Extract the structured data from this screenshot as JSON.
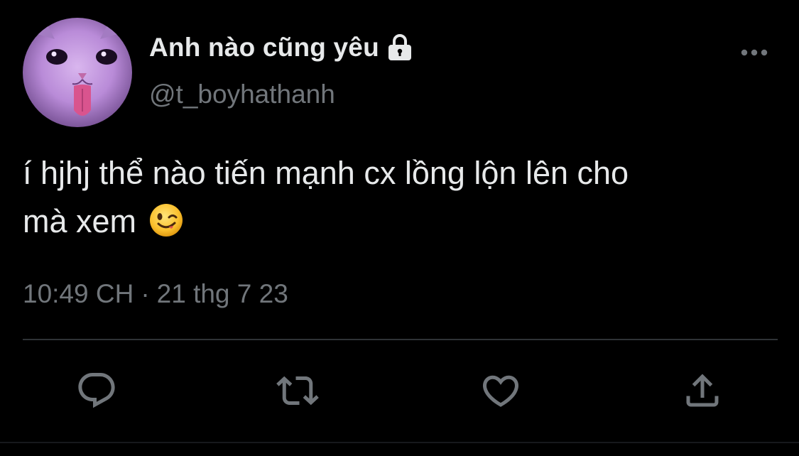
{
  "user": {
    "display_name": "Anh nào cũng yêu",
    "handle": "@t_boyhathanh",
    "avatar": "cat-avatar",
    "protected_icon": "lock-icon"
  },
  "tweet": {
    "text_line_1": "í hjhj thể nào tiến mạnh cx lồng lộn lên cho",
    "text_line_2": "mà xem",
    "emoji": "winking-face-emoji"
  },
  "meta": {
    "time": "10:49 CH",
    "separator": "·",
    "date": "21 thg 7 23"
  },
  "menu": {
    "more_icon": "more-horizontal-icon"
  },
  "actions": [
    {
      "name": "reply",
      "icon": "reply-icon"
    },
    {
      "name": "retweet",
      "icon": "retweet-icon"
    },
    {
      "name": "like",
      "icon": "heart-icon"
    },
    {
      "name": "share",
      "icon": "share-icon"
    }
  ],
  "colors": {
    "background": "#000000",
    "primary_text": "#e7e9ea",
    "secondary_text": "#71767b",
    "divider": "#2f3336",
    "avatar_tint": "#b689d9"
  }
}
